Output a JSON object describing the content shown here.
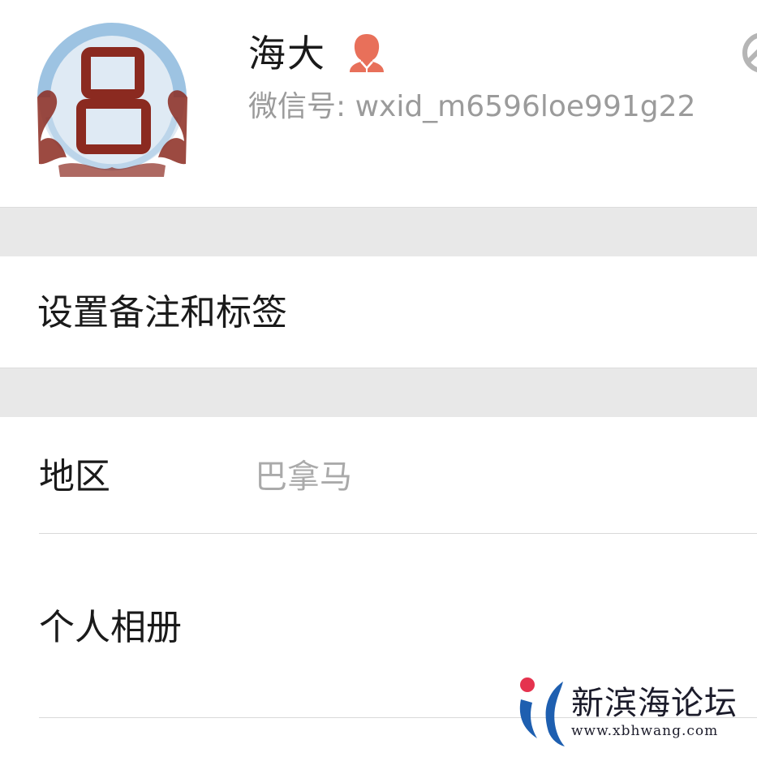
{
  "profile": {
    "name": "海大",
    "wechat_id": "微信号: wxid_m6596loe991g22",
    "gender_icon": "female-user-icon",
    "avatar_icon": "logo-avatar-icon"
  },
  "rows": {
    "remark": {
      "label": "设置备注和标签"
    },
    "region": {
      "label": "地区",
      "value": "巴拿马"
    },
    "album": {
      "label": "个人相册"
    }
  },
  "watermark": {
    "title": "新滨海论坛",
    "url": "www.xbhwang.com"
  },
  "colors": {
    "gender_icon": "#e8705a",
    "secondary_text": "#9b9b9b",
    "section_gap": "#e8e8e8",
    "avatar_ring": "#9dc3e2",
    "avatar_mark": "#8b2a20"
  }
}
